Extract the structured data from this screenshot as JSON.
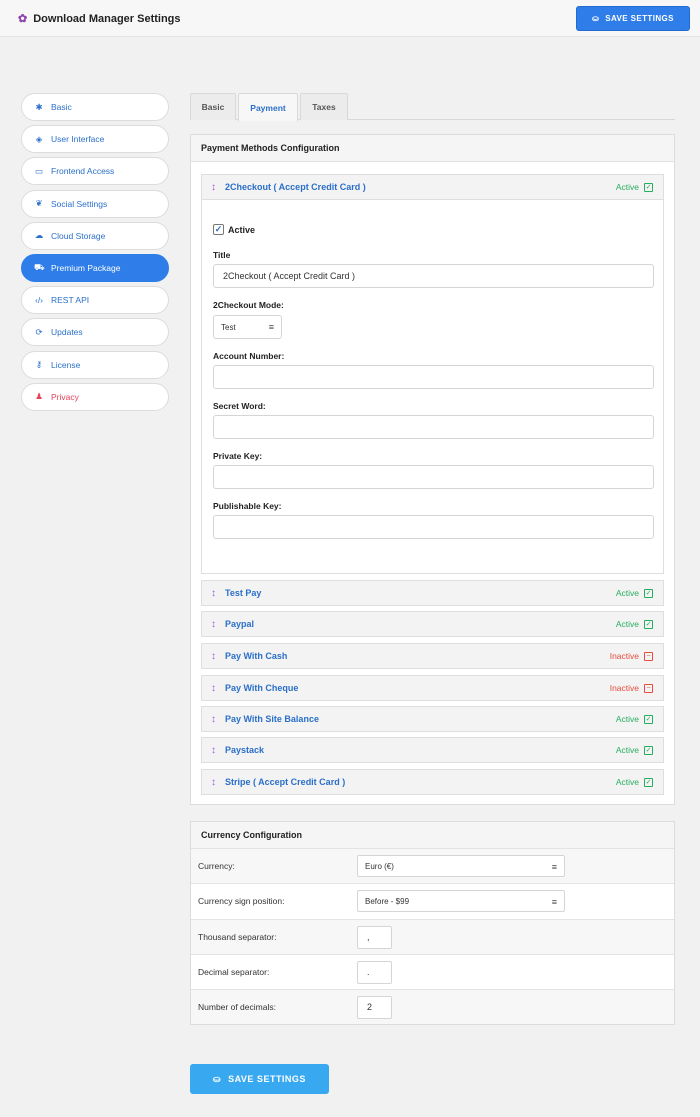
{
  "header": {
    "title": "Download Manager Settings",
    "save_label": "SAVE SETTINGS"
  },
  "sidebar": {
    "items": [
      {
        "label": "Basic",
        "icon": "gear-icon"
      },
      {
        "label": "User Interface",
        "icon": "paint-bucket-icon"
      },
      {
        "label": "Frontend Access",
        "icon": "desktop-icon"
      },
      {
        "label": "Social Settings",
        "icon": "twitter-icon"
      },
      {
        "label": "Cloud Storage",
        "icon": "cloud-icon"
      },
      {
        "label": "Premium Package",
        "icon": "cart-icon"
      },
      {
        "label": "REST API",
        "icon": "code-icon"
      },
      {
        "label": "Updates",
        "icon": "sync-icon"
      },
      {
        "label": "License",
        "icon": "key-icon"
      },
      {
        "label": "Privacy",
        "icon": "user-lock-icon"
      }
    ],
    "active": "Premium Package"
  },
  "tabs": [
    {
      "label": "Basic"
    },
    {
      "label": "Payment"
    },
    {
      "label": "Taxes"
    }
  ],
  "payment": {
    "heading": "Payment Methods Configuration",
    "expanded": {
      "name": "2Checkout ( Accept Credit Card )",
      "status": "Active",
      "active_label": "Active",
      "title_label": "Title",
      "title_value": "2Checkout ( Accept Credit Card )",
      "mode_label": "2Checkout Mode:",
      "mode_value": "Test",
      "account_label": "Account Number:",
      "secret_label": "Secret Word:",
      "private_label": "Private Key:",
      "publishable_label": "Publishable Key:"
    },
    "methods": [
      {
        "name": "Test Pay",
        "status": "Active"
      },
      {
        "name": "Paypal",
        "status": "Active"
      },
      {
        "name": "Pay With Cash",
        "status": "Inactive"
      },
      {
        "name": "Pay With Cheque",
        "status": "Inactive"
      },
      {
        "name": "Pay With Site Balance",
        "status": "Active"
      },
      {
        "name": "Paystack",
        "status": "Active"
      },
      {
        "name": "Stripe ( Accept Credit Card )",
        "status": "Active"
      }
    ]
  },
  "currency": {
    "heading": "Currency Configuration",
    "rows": [
      {
        "label": "Currency:",
        "value": "Euro (€)"
      },
      {
        "label": "Currency sign position:",
        "value": "Before - $99"
      },
      {
        "label": "Thousand separator:",
        "value": ","
      },
      {
        "label": "Decimal separator:",
        "value": "."
      },
      {
        "label": "Number of decimals:",
        "value": "2"
      }
    ]
  },
  "footer": {
    "save_label": "SAVE SETTINGS"
  },
  "colors": {
    "accent": "#2e7de9",
    "active": "#27ae60",
    "inactive": "#e74c3c",
    "drag": "#a05ad8"
  }
}
